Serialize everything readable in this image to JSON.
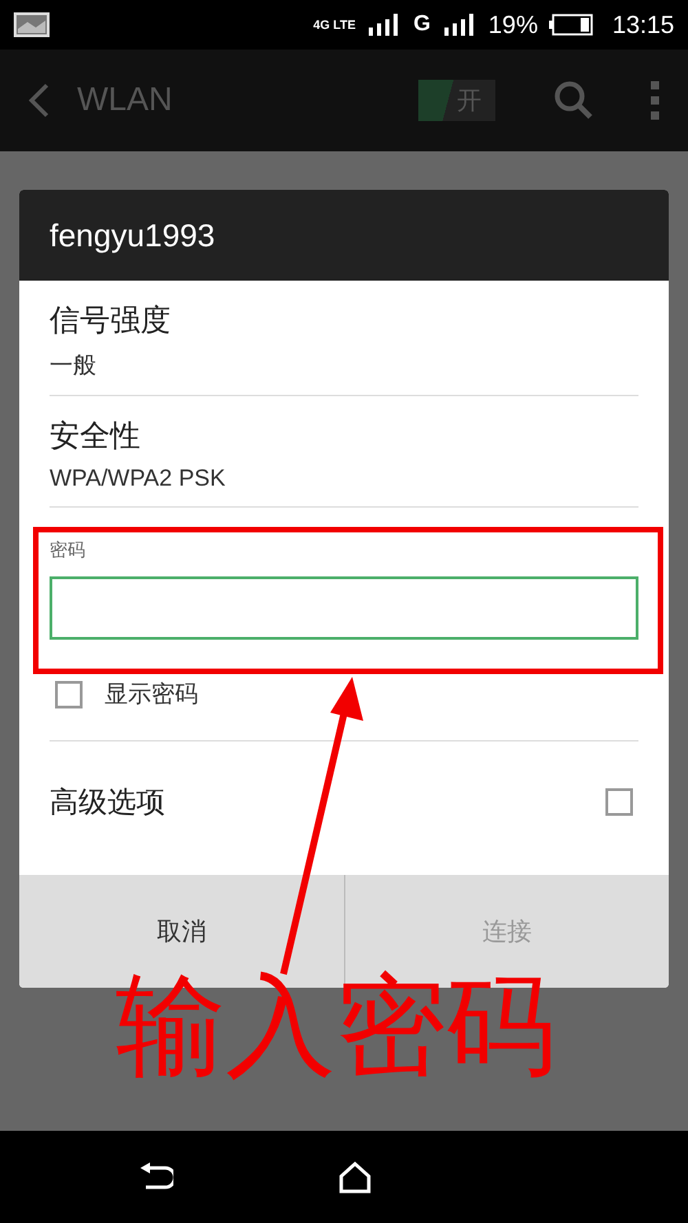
{
  "status_bar": {
    "network": "4G LTE",
    "network_2": "G",
    "battery": "19%",
    "time": "13:15"
  },
  "app_bar": {
    "title": "WLAN",
    "switch": {
      "label": "开",
      "on": true
    }
  },
  "dialog": {
    "title": "fengyu1993",
    "signal": {
      "label": "信号强度",
      "value": "一般"
    },
    "security": {
      "label": "安全性",
      "value": "WPA/WPA2 PSK"
    },
    "password": {
      "label": "密码"
    },
    "show_password": {
      "label": "显示密码",
      "checked": false
    },
    "advanced": {
      "label": "高级选项",
      "checked": false
    },
    "buttons": [
      {
        "label": "取消",
        "disabled": false
      },
      {
        "label": "连接",
        "disabled": true
      }
    ]
  },
  "annotation": {
    "text": "输入密码"
  }
}
